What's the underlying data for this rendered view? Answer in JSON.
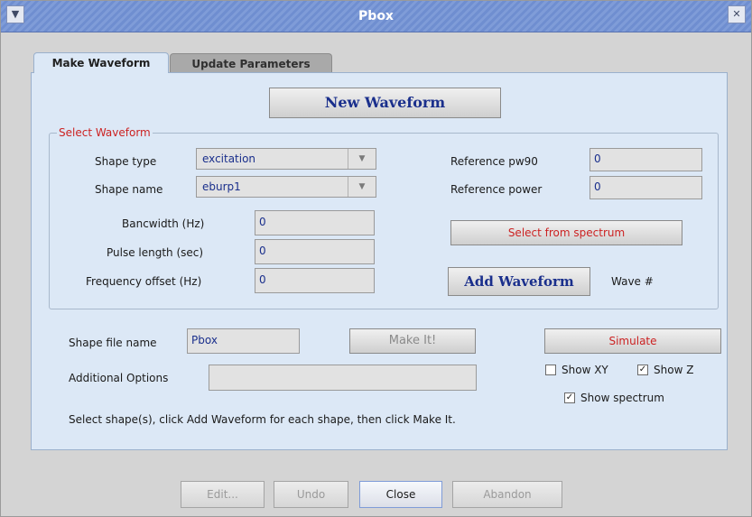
{
  "window": {
    "title": "Pbox",
    "menu_icon": "chevron-down-icon",
    "close_icon": "close-icon"
  },
  "tabs": [
    {
      "label": "Make Waveform",
      "active": true
    },
    {
      "label": "Update Parameters",
      "active": false
    }
  ],
  "new_waveform_button": "New Waveform",
  "select_waveform": {
    "title": "Select Waveform",
    "shape_type": {
      "label": "Shape type",
      "value": "excitation"
    },
    "shape_name": {
      "label": "Shape name",
      "value": "eburp1"
    },
    "bandwidth": {
      "label": "Bancwidth (Hz)",
      "value": "0"
    },
    "pulse_length": {
      "label": "Pulse length (sec)",
      "value": "0"
    },
    "frequency_offset": {
      "label": "Frequency offset (Hz)",
      "value": "0"
    },
    "reference_pw90": {
      "label": "Reference pw90",
      "value": "0"
    },
    "reference_power": {
      "label": "Reference power",
      "value": "0"
    },
    "select_from_spectrum": "Select from spectrum",
    "add_waveform": "Add Waveform",
    "wave_number_label": "Wave #"
  },
  "shape_file": {
    "label": "Shape file name",
    "value": "Pbox"
  },
  "make_it_button": "Make It!",
  "simulate_button": "Simulate",
  "additional_options": {
    "label": "Additional Options",
    "value": ""
  },
  "show_xy": {
    "label": "Show XY",
    "checked": false
  },
  "show_z": {
    "label": "Show Z",
    "checked": true
  },
  "show_spectrum": {
    "label": "Show spectrum",
    "checked": true
  },
  "instructions": "Select shape(s), click Add Waveform for each shape, then click Make It.",
  "bottom_buttons": {
    "edit": "Edit...",
    "undo": "Undo",
    "close": "Close",
    "abandon": "Abandon"
  },
  "colors": {
    "accent_red": "#cc2222",
    "accent_blue": "#1a2f8c",
    "title_bar": "#7f9cd8",
    "panel_bg": "#dce8f6"
  }
}
